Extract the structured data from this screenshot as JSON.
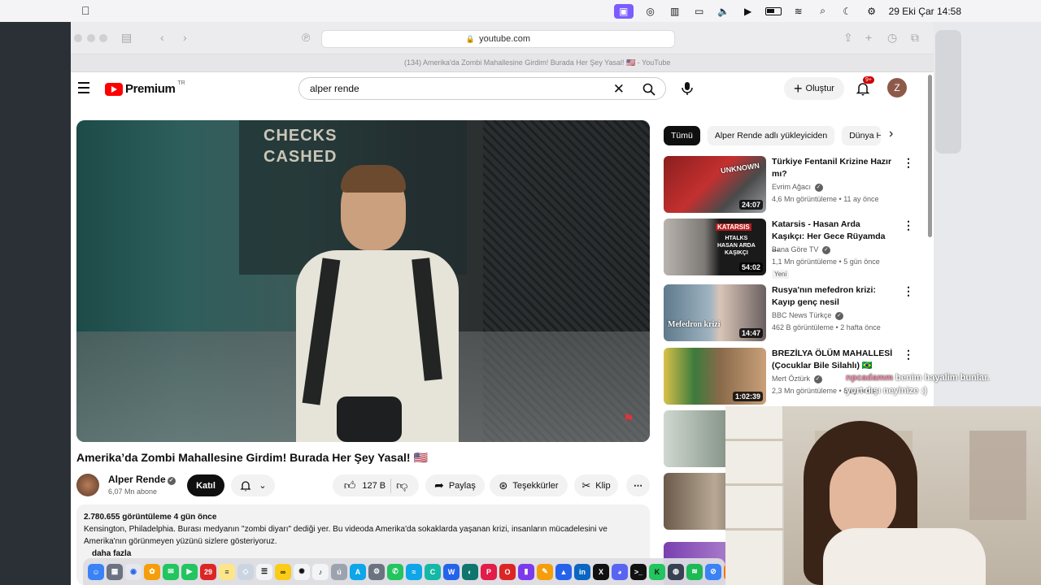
{
  "menubar": {
    "date_time": "29 Eki Çar  14:58"
  },
  "safari": {
    "address": "youtube.com",
    "tab_title": "(134) Amerika'da Zombi Mahallesine Girdim! Burada Her Şey Yasal! 🇺🇸 - YouTube"
  },
  "youtube": {
    "logo_text": "Premium",
    "logo_region": "TR",
    "search_value": "alper rende",
    "create_label": "Oluştur",
    "notification_count": "9+",
    "avatar_letter": "Z",
    "player": {
      "sign_text": "CHECKS\nCASHED"
    },
    "video": {
      "title": "Amerika’da Zombi Mahallesine Girdim! Burada Her Şey Yasal! 🇺🇸",
      "channel": "Alper Rende",
      "subscribers": "6,07 Mn abone",
      "join_label": "Katıl",
      "likes": "127 B",
      "share_label": "Paylaş",
      "thanks_label": "Teşekkürler",
      "clip_label": "Klip",
      "views_date": "2.780.655 görüntüleme  4 gün önce",
      "description": "Kensington, Philadelphia. Burası medyanın \"zombi diyarı\" dediği yer. Bu videoda Amerika'da sokaklarda yaşanan krizi, insanların mücadelesini ve Amerika'nın görünmeyen yüzünü sizlere gösteriyoruz.",
      "more_label": "daha fazla"
    },
    "chips": [
      "Tümü",
      "Alper Rende adlı yükleyiciden",
      "Dünya H"
    ],
    "recommendations": [
      {
        "title": "Türkiye Fentanil Krizine Hazır mı?",
        "channel": "Evrim Ağacı",
        "meta": "4,6 Mn görüntüleme • 11 ay önce",
        "duration": "24:07",
        "badge": ""
      },
      {
        "title": "Katarsis - Hasan Arda Kaşıkçı: Her Gece Rüyamda ...",
        "channel": "Bana Göre TV",
        "meta": "1,1 Mn görüntüleme • 5 gün önce",
        "duration": "54:02",
        "badge": "Yeni"
      },
      {
        "title": "Rusya'nın mefedron krizi: Kayıp genç nesil",
        "channel": "BBC News Türkçe",
        "meta": "462 B görüntüleme • 2 hafta önce",
        "duration": "14:47",
        "badge": ""
      },
      {
        "title": "BREZİLYA ÖLÜM MAHALLESİ (Çocuklar Bile Silahlı) 🇧🇷",
        "channel": "Mert Öztürk",
        "meta": "2,3 Mn görüntüleme • 8 ay önce",
        "duration": "1:02:39",
        "badge": ""
      }
    ],
    "thumb_texts": {
      "t1": "UNKNOWN",
      "t2a": "KATARSIS",
      "t2b": "HTALKS\nHASAN ARDA\nKAŞIKÇI",
      "t3": "Mefedron krizi"
    }
  },
  "chat_overlay": {
    "nick": "npcadamm",
    "message": "benim hayalim bunlar. yurt dışı neyinize :)"
  },
  "colors": {
    "yt_red": "#ff0000",
    "menubar_accent": "#7c5cff"
  }
}
